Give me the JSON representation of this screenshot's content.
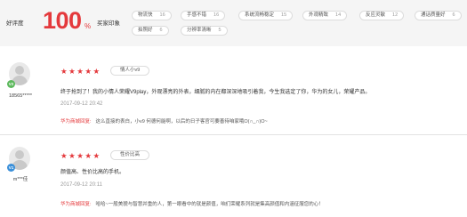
{
  "summary": {
    "good_label": "好评度",
    "good_value": "100",
    "good_unit": "%",
    "impression_label": "买家印象",
    "tags": [
      {
        "label": "物流快",
        "count": "16"
      },
      {
        "label": "手感不错",
        "count": "16"
      },
      {
        "label": "系统流畅稳定",
        "count": "15"
      },
      {
        "label": "外观精致",
        "count": "14"
      },
      {
        "label": "反应灵敏",
        "count": "12"
      },
      {
        "label": "通话质量好",
        "count": "6"
      },
      {
        "label": "拍照好",
        "count": "6"
      },
      {
        "label": "分辨率清晰",
        "count": "5"
      }
    ]
  },
  "reviews": [
    {
      "username": "18565*****",
      "vip_badge": "V2",
      "vip_color": "#5cb85c",
      "stars": "★★★★★",
      "tag": "情人小v9",
      "text": "终于抢到了！我的小情人荣耀V9play，外观漂亮的外表，细腻的内在都深深地吸引着我，今生我选定了你，华为的女儿，荣耀产品。",
      "date": "2017-09-12 20:42",
      "reply_by": "华为商城回复:",
      "reply_text": "这么直接的表白，小v9 何德何能啊，以后的日子客官可要善待咱家哦O(∩_∩)O~"
    },
    {
      "username": "m***佳",
      "vip_badge": "V1",
      "vip_color": "#3a8fd9",
      "stars": "★★★★★",
      "tag": "性价比高",
      "text": "颜值高、性价比高的手机。",
      "date": "2017-09-12 20:11",
      "reply_by": "华为商城回复:",
      "reply_text": "哈哈~一般美貌与智慧并重的人，第一眼看中的就是颜值，咱们荣耀系列就是集高颜值和内涵征服您的心！"
    }
  ]
}
